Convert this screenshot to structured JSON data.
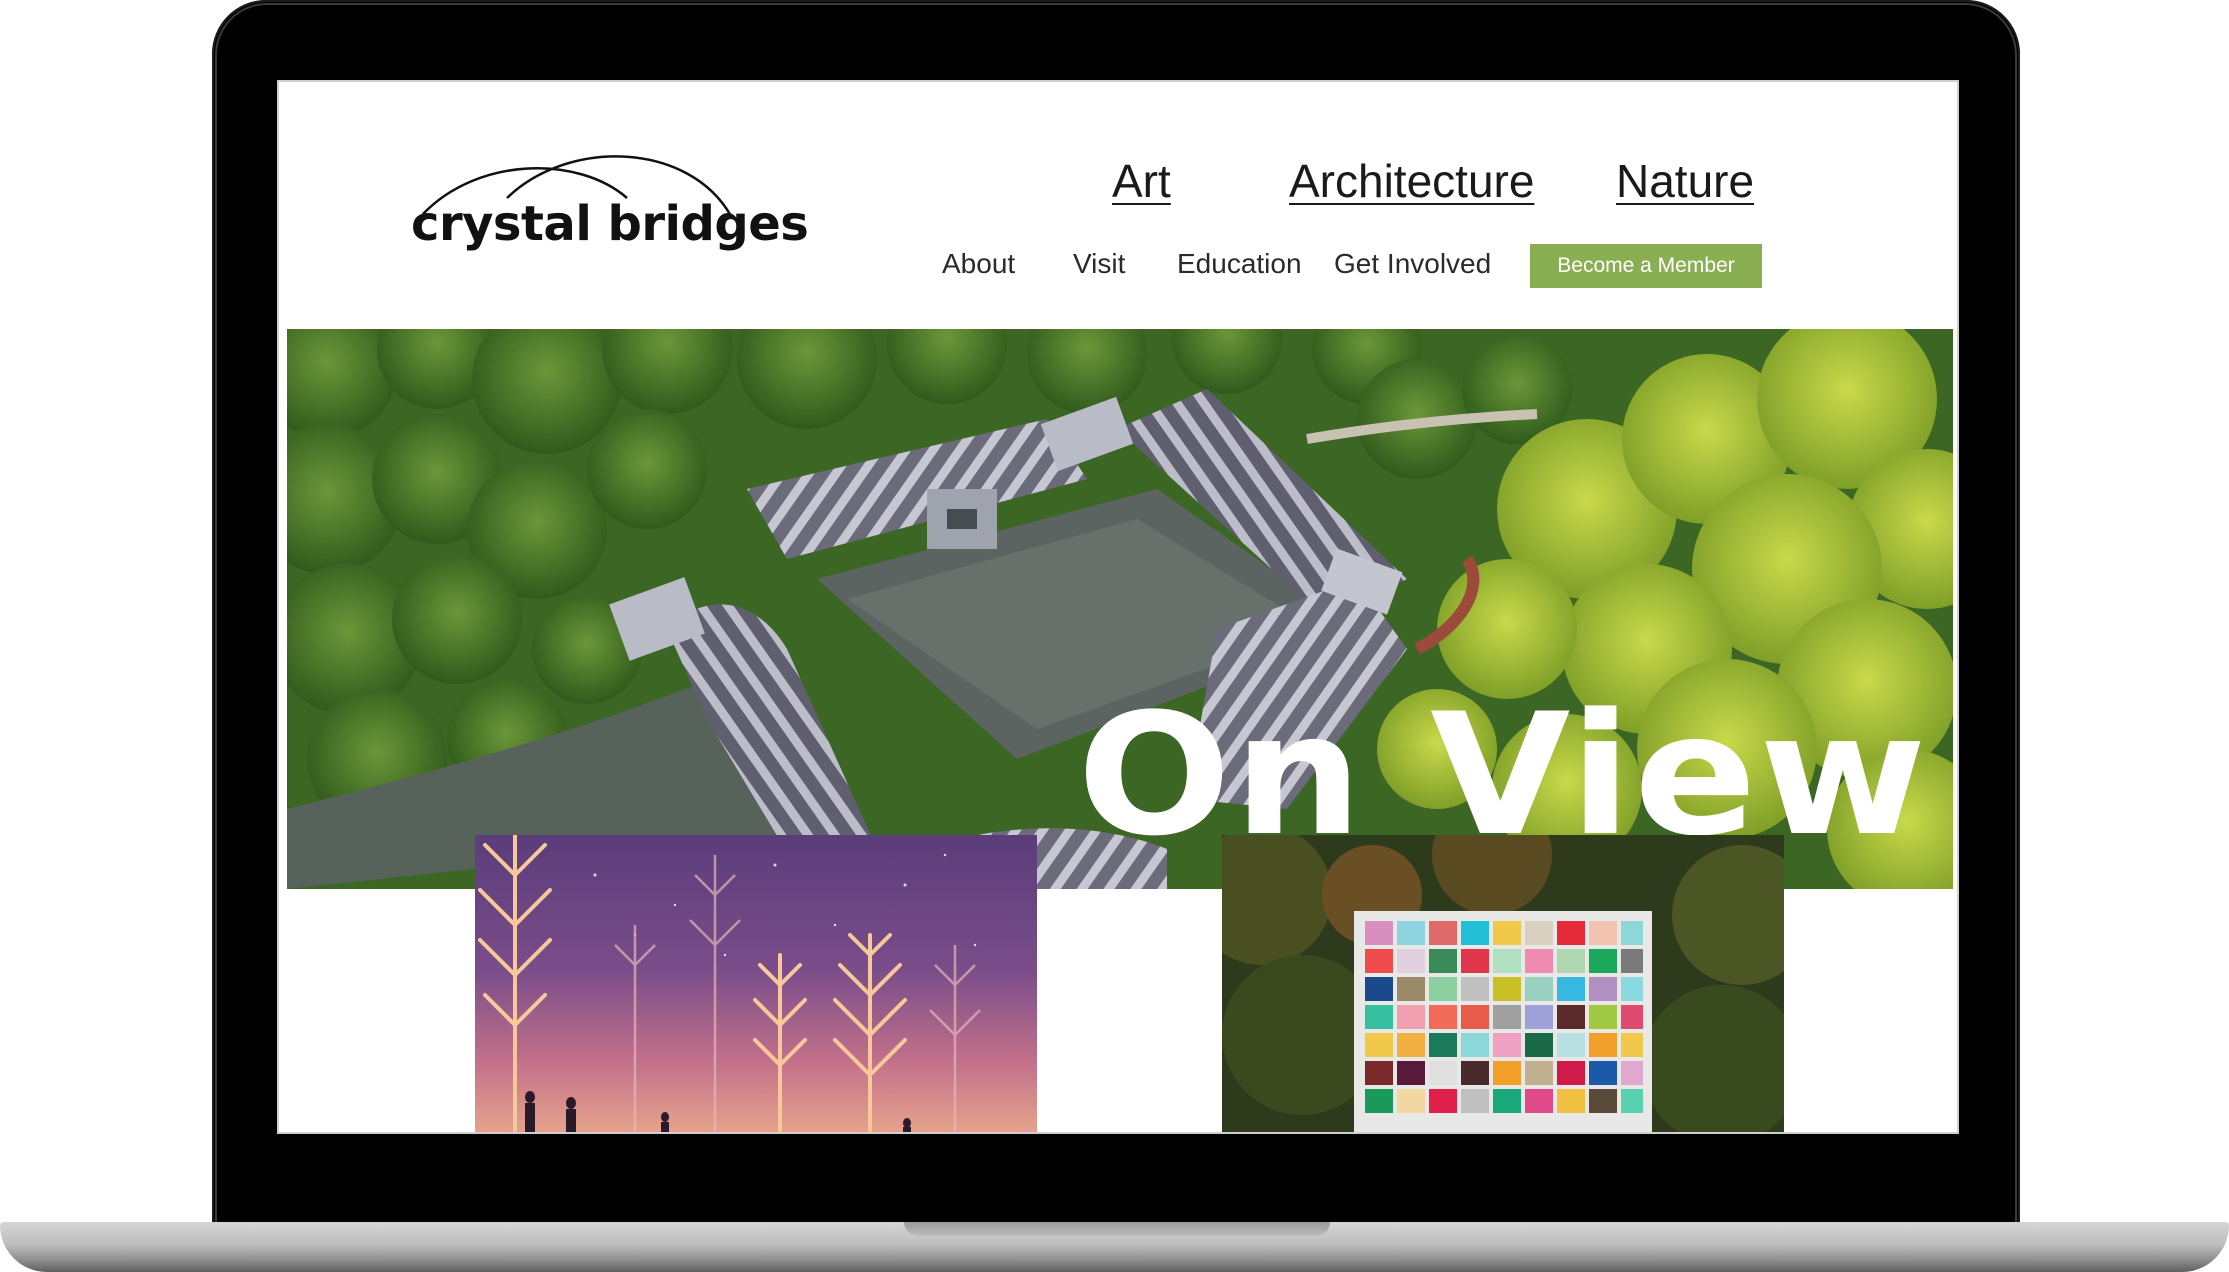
{
  "brand": {
    "logo_text": "crystal bridges"
  },
  "primary_nav": [
    {
      "label": "Art"
    },
    {
      "label": "Architecture"
    },
    {
      "label": "Nature"
    }
  ],
  "secondary_nav": [
    {
      "label": "About"
    },
    {
      "label": "Visit"
    },
    {
      "label": "Education"
    },
    {
      "label": "Get Involved"
    }
  ],
  "cta": {
    "label": "Become a Member"
  },
  "hero": {
    "title": "On View"
  },
  "colors": {
    "accent": "#8aaf52",
    "text": "#1a1a1a"
  },
  "icons": [
    "bridge-arcs-logo"
  ]
}
